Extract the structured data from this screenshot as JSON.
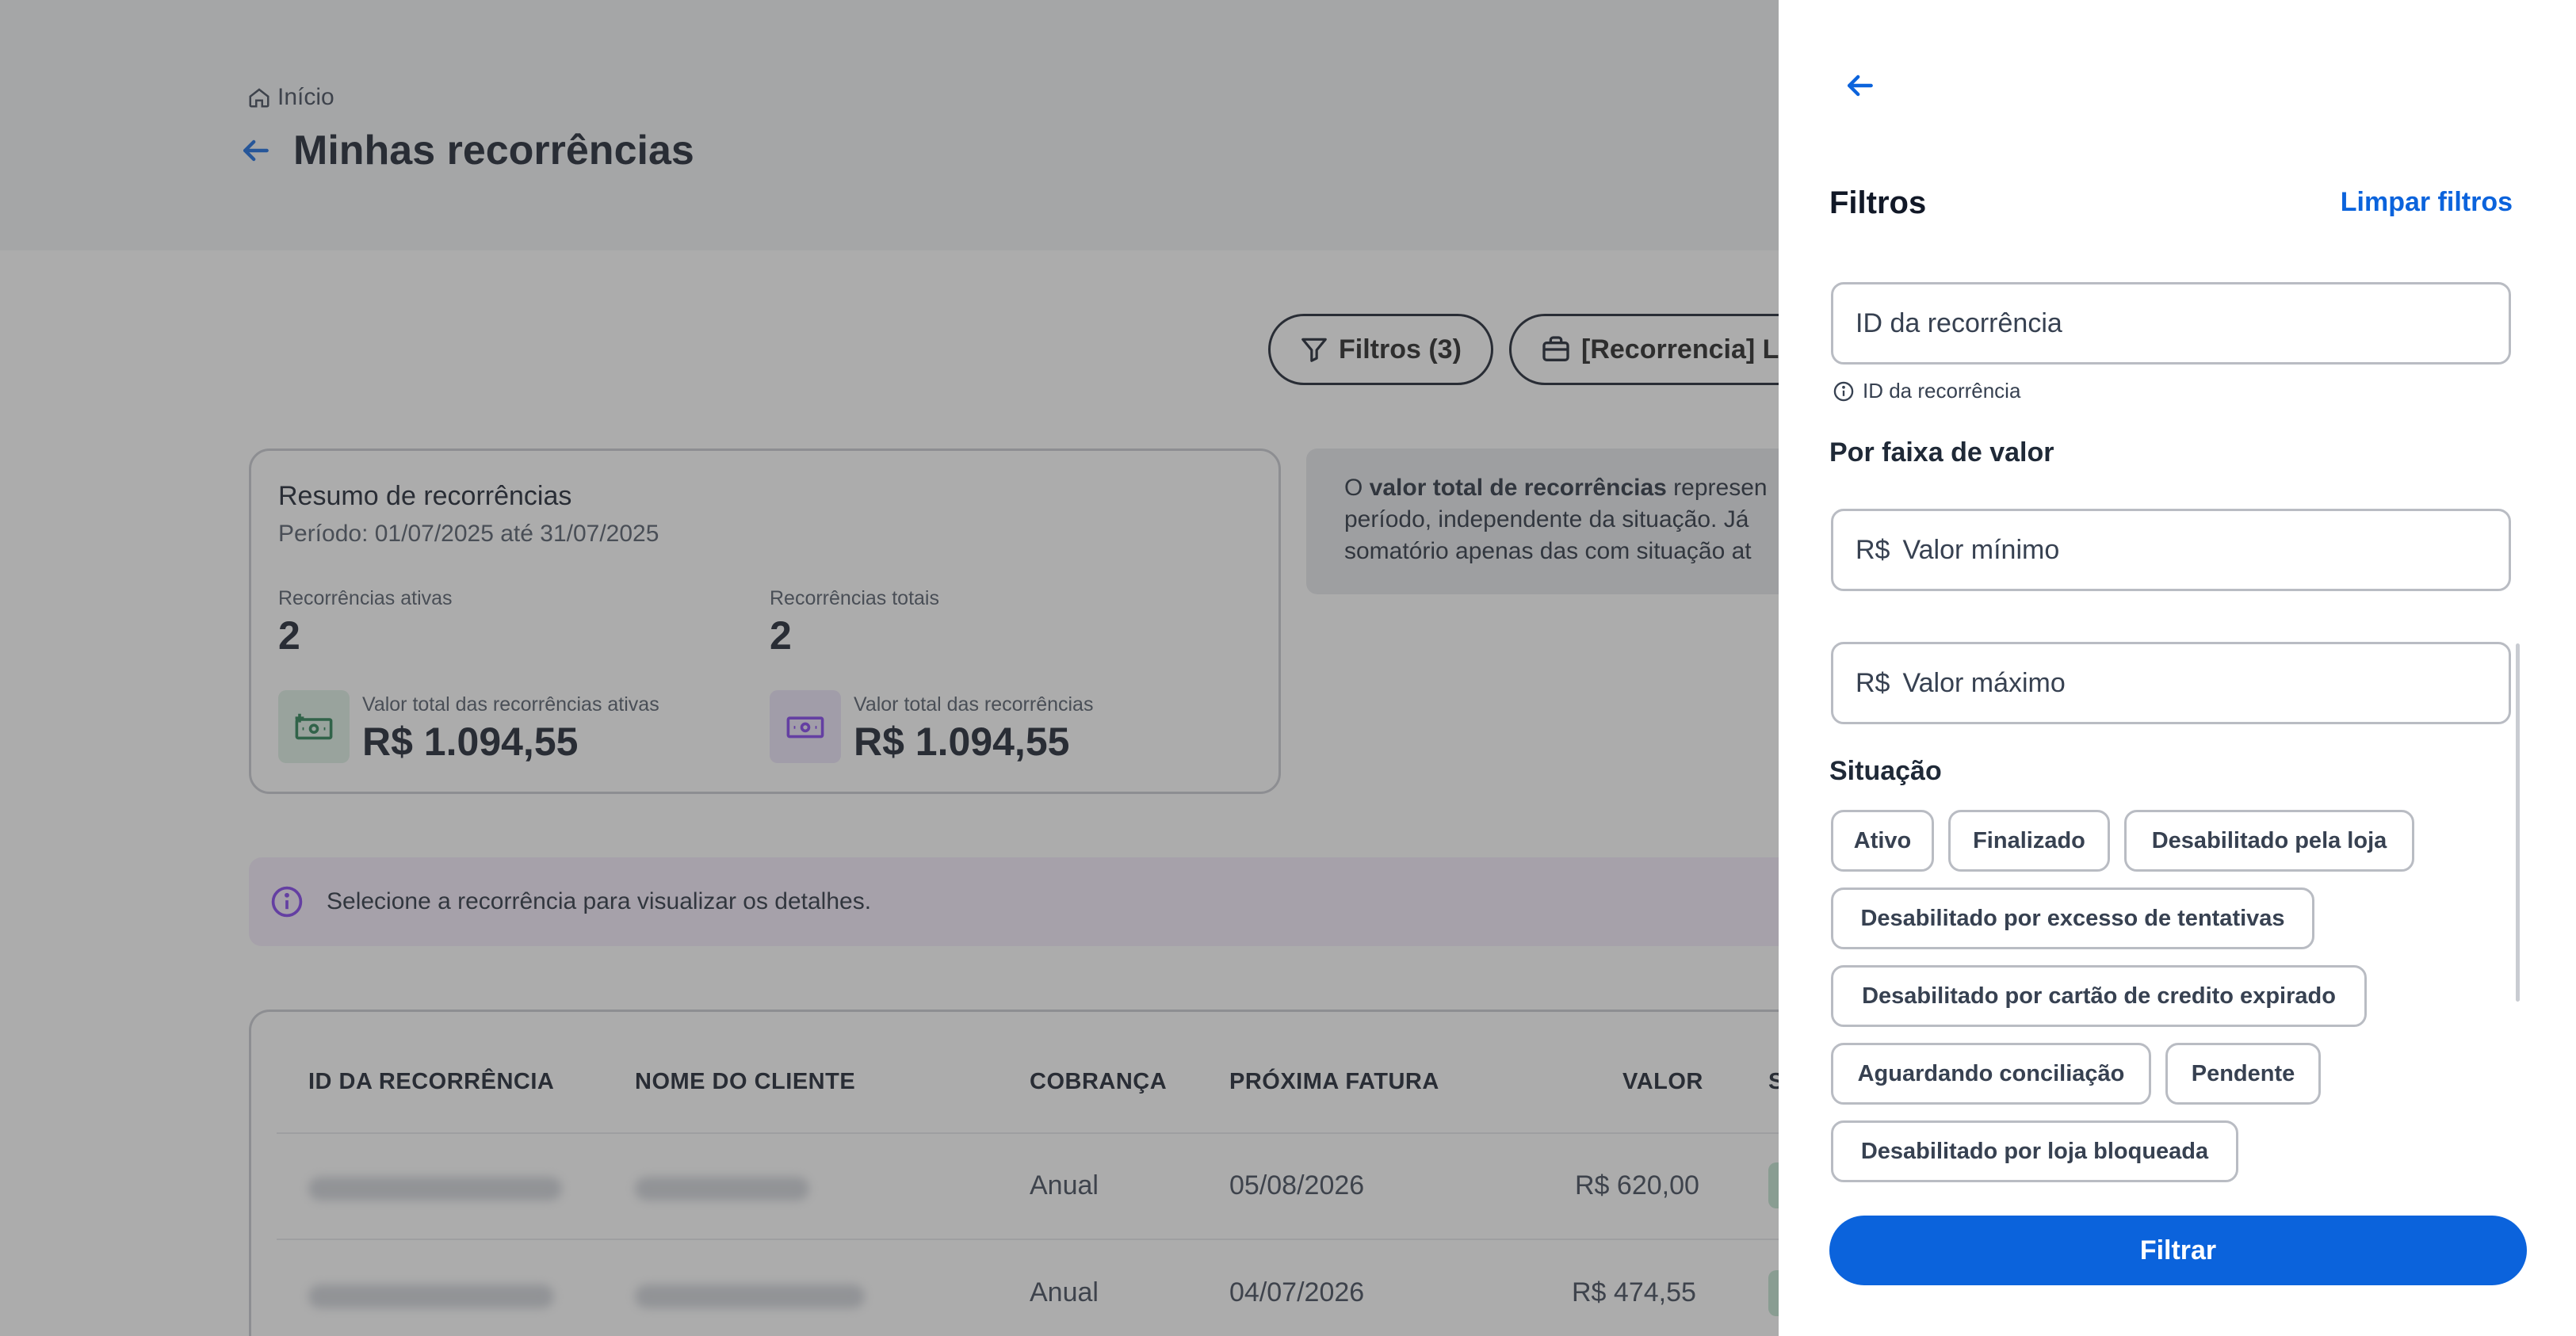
{
  "breadcrumb": {
    "label": "Início",
    "icon": "home-icon"
  },
  "page": {
    "title": "Minhas recorrências"
  },
  "actions": {
    "filters_label": "Filtros (3)",
    "report_label": "[Recorrencia] L"
  },
  "summary": {
    "title": "Resumo de recorrências",
    "period": "Período: 01/07/2025 até 31/07/2025",
    "active_label": "Recorrências ativas",
    "active_count": "2",
    "total_label": "Recorrências totais",
    "total_count": "2",
    "active_value_label": "Valor total das recorrências ativas",
    "active_value": "R$ 1.094,55",
    "total_value_label": "Valor total das recorrências",
    "total_value": "R$ 1.094,55",
    "active_icon_color": "#1f7a4c",
    "total_icon_color": "#7c3aed"
  },
  "info_note": {
    "line1_prefix": "O ",
    "line1_bold": "valor total de recorrências",
    "line1_suffix": " represen",
    "line2": "período, independente da situação. Já",
    "line3": "somatório apenas das com situação at"
  },
  "banner": {
    "text": "Selecione a recorrência para visualizar os detalhes."
  },
  "table": {
    "headers": [
      "ID DA RECORRÊNCIA",
      "NOME DO CLIENTE",
      "COBRANÇA",
      "PRÓXIMA FATURA",
      "VALOR",
      "SI"
    ],
    "rows": [
      {
        "cobranca": "Anual",
        "proxima_fatura": "05/08/2026",
        "valor": "R$ 620,00"
      },
      {
        "cobranca": "Anual",
        "proxima_fatura": "04/07/2026",
        "valor": "R$ 474,55"
      }
    ]
  },
  "drawer": {
    "title": "Filtros",
    "clear_label": "Limpar filtros",
    "id_field": {
      "placeholder": "ID da recorrência",
      "value": ""
    },
    "id_helper": "ID da recorrência",
    "value_range_title": "Por faixa de valor",
    "min_field": {
      "prefix": "R$",
      "placeholder": "Valor mínimo",
      "value": ""
    },
    "max_field": {
      "prefix": "R$",
      "placeholder": "Valor máximo",
      "value": ""
    },
    "status_title": "Situação",
    "status_chips": [
      "Ativo",
      "Finalizado",
      "Desabilitado pela loja",
      "Desabilitado por excesso de tentativas",
      "Desabilitado por cartão de credito expirado",
      "Aguardando conciliação",
      "Pendente",
      "Desabilitado por loja bloqueada"
    ],
    "submit_label": "Filtrar",
    "accent_color": "#0b63dc"
  }
}
